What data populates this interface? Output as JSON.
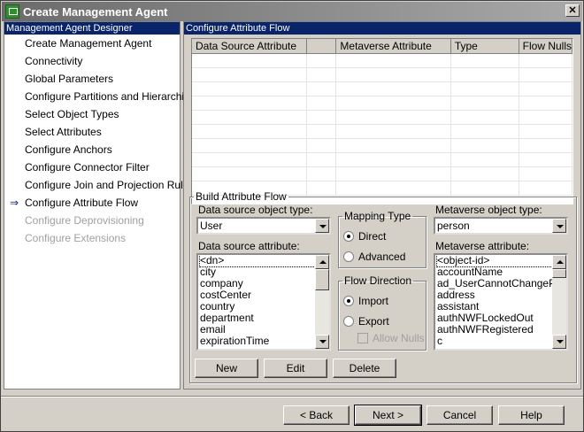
{
  "window": {
    "title": "Create Management Agent",
    "close_label": "✕"
  },
  "sidebar": {
    "header": "Management Agent Designer",
    "items": [
      {
        "label": "Create Management Agent"
      },
      {
        "label": "Connectivity"
      },
      {
        "label": "Global Parameters"
      },
      {
        "label": "Configure Partitions and Hierarchies"
      },
      {
        "label": "Select Object Types"
      },
      {
        "label": "Select Attributes"
      },
      {
        "label": "Configure Anchors"
      },
      {
        "label": "Configure Connector Filter"
      },
      {
        "label": "Configure Join and Projection Rules"
      },
      {
        "label": "Configure Attribute Flow",
        "current": true
      },
      {
        "label": "Configure Deprovisioning",
        "disabled": true
      },
      {
        "label": "Configure Extensions",
        "disabled": true
      }
    ],
    "current_arrow": "⇒"
  },
  "main": {
    "header": "Configure Attribute Flow",
    "grid": {
      "columns": [
        "Data Source Attribute",
        "",
        "Metaverse Attribute",
        "Type",
        "Flow Nulls"
      ],
      "rows": []
    },
    "build": {
      "legend": "Build Attribute Flow",
      "ds_type_label": "Data source object type:",
      "ds_type_value": "User",
      "ds_attr_label": "Data source attribute:",
      "ds_attrs": [
        "<dn>",
        "city",
        "company",
        "costCenter",
        "country",
        "department",
        "email",
        "expirationTime"
      ],
      "mapping_legend": "Mapping Type",
      "mapping_direct": "Direct",
      "mapping_advanced": "Advanced",
      "mapping_selected": "Direct",
      "flow_legend": "Flow Direction",
      "flow_import": "Import",
      "flow_export": "Export",
      "flow_selected": "Import",
      "allow_nulls": "Allow Nulls",
      "mv_type_label": "Metaverse object type:",
      "mv_type_value": "person",
      "mv_attr_label": "Metaverse attribute:",
      "mv_attrs": [
        "<object-id>",
        "accountName",
        "ad_UserCannotChangePass",
        "address",
        "assistant",
        "authNWFLockedOut",
        "authNWFRegistered",
        "c"
      ],
      "new_label": "New",
      "edit_label": "Edit",
      "delete_label": "Delete"
    }
  },
  "footer": {
    "back_label": "< Back",
    "next_label": "Next >",
    "cancel_label": "Cancel",
    "help_label": "Help"
  }
}
